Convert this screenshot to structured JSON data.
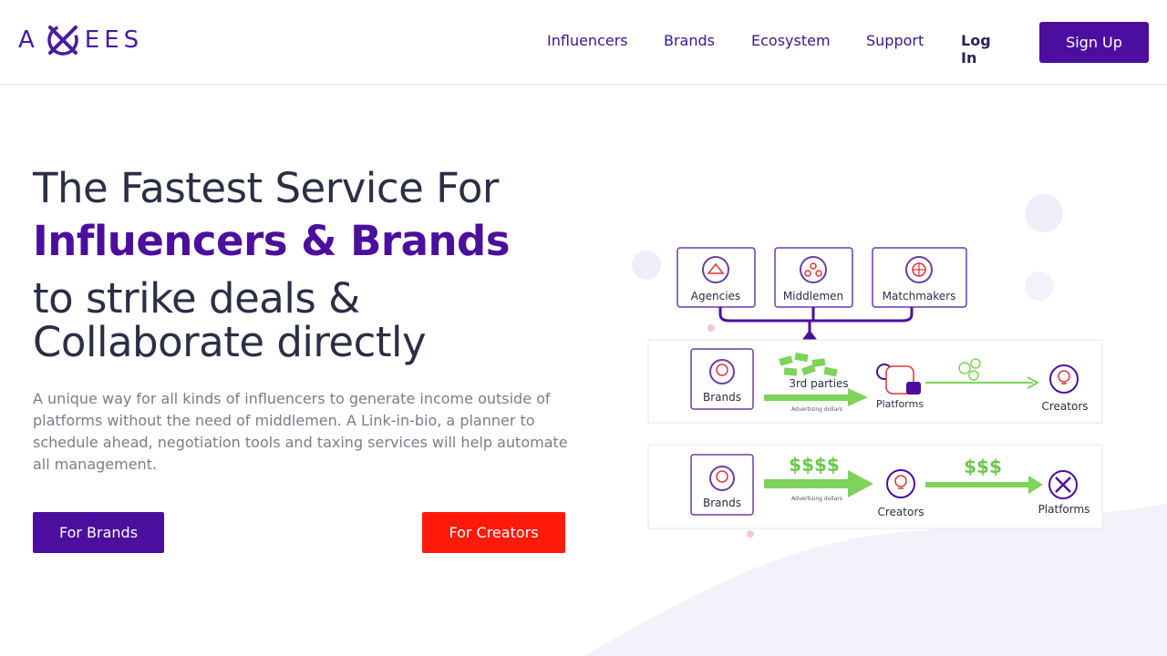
{
  "brand": {
    "logo_left": "A",
    "logo_right": "EES",
    "primary_color": "#4b0e9e",
    "accent_color": "#ff1a0a"
  },
  "nav": {
    "links": [
      "Influencers",
      "Brands",
      "Ecosystem",
      "Support"
    ],
    "login": "Log In",
    "signup": "Sign Up"
  },
  "hero": {
    "line1": "The Fastest Service For",
    "line2": "Influencers & Brands",
    "line3a": "to strike deals &",
    "line3b": "Collaborate directly",
    "description": "A unique way for all kinds of influencers to generate income outside of platforms without the need of middlemen. A Link-in-bio, a planner to schedule ahead, negotiation tools and taxing services will help automate all management.",
    "btn_brands": "For Brands",
    "btn_creators": "For Creators"
  },
  "diagram": {
    "top_boxes": [
      "Agencies",
      "Middlemen",
      "Matchmakers"
    ],
    "row1": {
      "from": "Brands",
      "middle": "3rd parties",
      "caption": "Advertising dollars",
      "to1": "Platforms",
      "to2": "Creators"
    },
    "row2": {
      "from": "Brands",
      "money1": "$$$$",
      "caption": "Advertising dollars",
      "to1": "Creators",
      "money2": "$$$",
      "to2": "Platforms"
    }
  }
}
